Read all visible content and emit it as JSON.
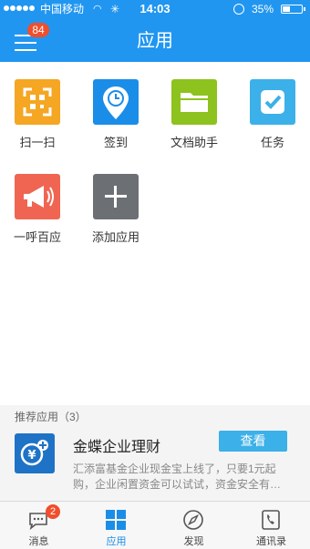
{
  "status": {
    "carrier": "中国移动",
    "time": "14:03",
    "battery": "35%",
    "battery_level": 0.35
  },
  "header": {
    "title": "应用",
    "menu_badge": "84"
  },
  "apps": [
    {
      "label": "扫一扫",
      "color": "#f5a623",
      "icon": "scan-icon"
    },
    {
      "label": "签到",
      "color": "#1a8de9",
      "icon": "location-pin-icon"
    },
    {
      "label": "文档助手",
      "color": "#8dc21f",
      "icon": "folder-icon"
    },
    {
      "label": "任务",
      "color": "#3cb0e8",
      "icon": "task-check-icon"
    },
    {
      "label": "一呼百应",
      "color": "#f06552",
      "icon": "megaphone-icon"
    },
    {
      "label": "添加应用",
      "color": "#6c6f73",
      "icon": "plus-icon"
    }
  ],
  "recommend": {
    "header": "推荐应用（3）",
    "name": "金蝶企业理财",
    "button": "查看",
    "description": "汇添富基金企业现金宝上线了，只要1元起购，企业闲置资金可以试试，资金安全有…",
    "icon": "finance-coin-icon"
  },
  "tabs": [
    {
      "label": "消息",
      "icon": "message-icon",
      "badge": "2"
    },
    {
      "label": "应用",
      "icon": "apps-grid-icon",
      "active": true
    },
    {
      "label": "发现",
      "icon": "compass-icon"
    },
    {
      "label": "通讯录",
      "icon": "contacts-icon"
    }
  ]
}
